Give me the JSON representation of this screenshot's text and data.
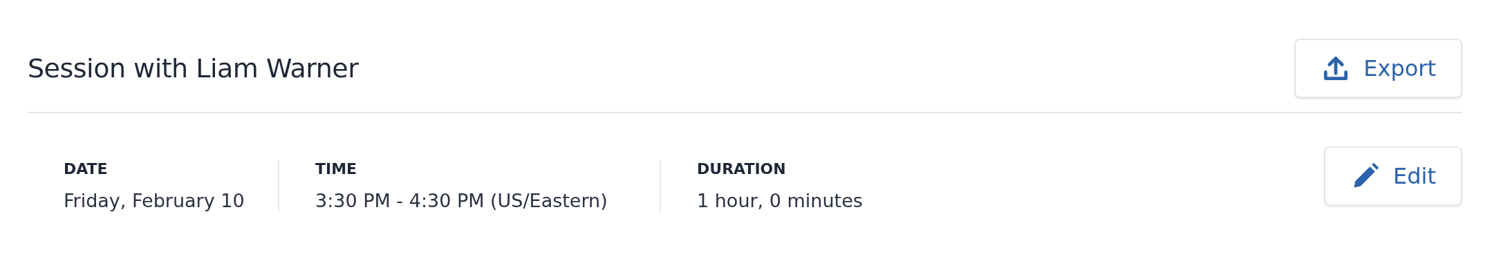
{
  "header": {
    "title": "Session with Liam Warner",
    "action": {
      "label": "Export",
      "kind": "export"
    }
  },
  "details": {
    "fields": [
      {
        "label": "DATE",
        "value": "Friday, February 10"
      },
      {
        "label": "TIME",
        "value": "3:30 PM - 4:30 PM (US/Eastern)"
      },
      {
        "label": "DURATION",
        "value": "1 hour, 0 minutes"
      }
    ],
    "action": {
      "label": "Edit",
      "kind": "edit"
    }
  }
}
